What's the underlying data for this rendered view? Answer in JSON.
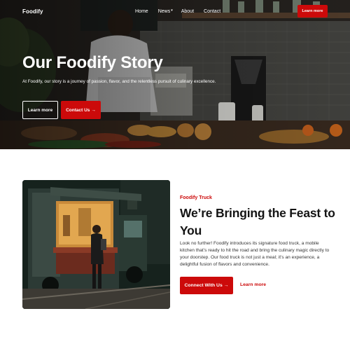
{
  "nav": {
    "brand": "Foodify",
    "links": [
      {
        "label": "Home"
      },
      {
        "label": "News"
      },
      {
        "label": "About"
      },
      {
        "label": "Contact"
      }
    ],
    "cta_label": "Learn more"
  },
  "hero": {
    "title": "Our Foodify Story",
    "subtitle": "At Foodify, our story is a journey of passion, flavor, and the relentless pursuit of culinary excellence.",
    "secondary_button": "Learn more",
    "primary_button": "Contact Us",
    "arrow": "→"
  },
  "feature": {
    "eyebrow": "Foodify Truck",
    "title": "We’re Bringing the Feast to You",
    "body": "Look no further! Foodify introduces its signature food truck, a mobile kitchen that’s ready to hit the road and bring the culinary magic directly to your doorstep. Our food truck is not just a meal; it’s an experience, a delightful fusion of flavors and convenience.",
    "primary_button": "Connect With Us",
    "arrow": "→",
    "link": "Learn more"
  },
  "colors": {
    "accent": "#cc0a0a",
    "text": "#141414"
  },
  "icons": {
    "dropdown": "caret-down-icon",
    "arrow": "arrow-right-icon"
  }
}
